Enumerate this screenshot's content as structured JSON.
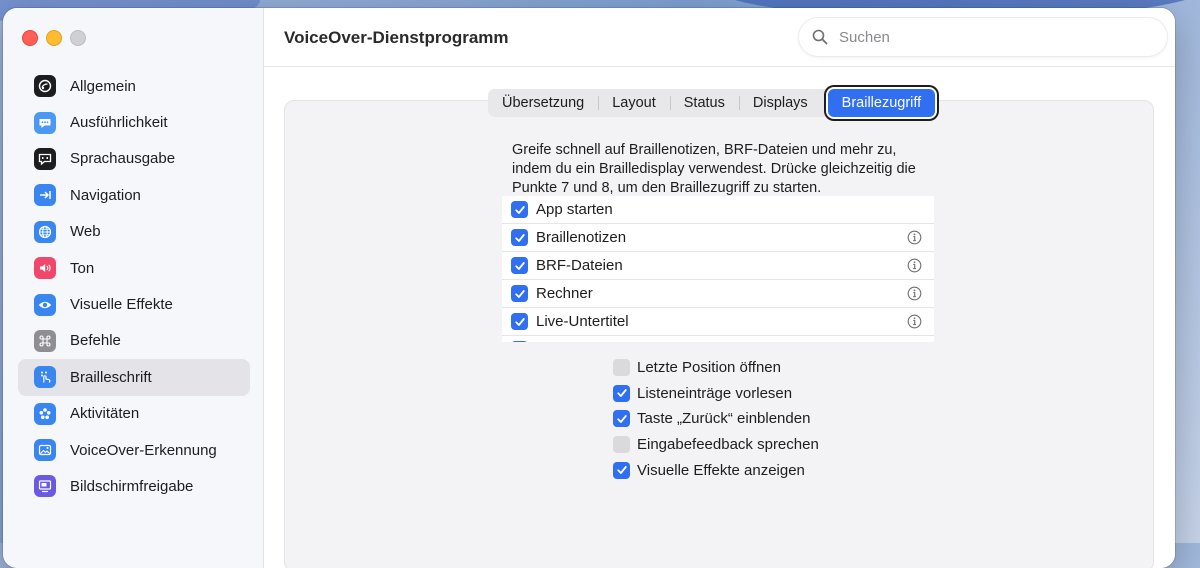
{
  "window": {
    "title": "VoiceOver-Dienstprogramm"
  },
  "search": {
    "placeholder": "Suchen"
  },
  "sidebar": {
    "items": [
      {
        "label": "Allgemein",
        "icon": "voiceover-icon",
        "color": "#1d1d1f"
      },
      {
        "label": "Ausführlichkeit",
        "icon": "speech-bubble-icon",
        "color": "#4a9af4"
      },
      {
        "label": "Sprachausgabe",
        "icon": "speech-icon",
        "color": "#1d1d1f"
      },
      {
        "label": "Navigation",
        "icon": "arrow-right-icon",
        "color": "#3a86f0"
      },
      {
        "label": "Web",
        "icon": "globe-icon",
        "color": "#3a86f0"
      },
      {
        "label": "Ton",
        "icon": "speaker-icon",
        "color": "#f0476a"
      },
      {
        "label": "Visuelle Effekte",
        "icon": "eye-icon",
        "color": "#3a86f0"
      },
      {
        "label": "Befehle",
        "icon": "command-icon",
        "color": "#8e8e93"
      },
      {
        "label": "Brailleschrift",
        "icon": "braille-icon",
        "color": "#3a86f0"
      },
      {
        "label": "Aktivitäten",
        "icon": "activities-icon",
        "color": "#3a86f0"
      },
      {
        "label": "VoiceOver-Erkennung",
        "icon": "recognition-icon",
        "color": "#3a86f0"
      },
      {
        "label": "Bildschirmfreigabe",
        "icon": "screen-sharing-icon",
        "color": "#6a5ae0"
      }
    ],
    "selected": "Brailleschrift"
  },
  "tabs": [
    {
      "label": "Übersetzung",
      "active": false
    },
    {
      "label": "Layout",
      "active": false
    },
    {
      "label": "Status",
      "active": false
    },
    {
      "label": "Displays",
      "active": false
    },
    {
      "label": "Braillezugriff",
      "active": true
    }
  ],
  "description": "Greife schnell auf Braillenotizen, BRF-Dateien und mehr zu, indem du ein Brailledisplay verwendest. Drücke gleichzeitig die Punkte 7 und 8, um den Braillezugriff zu starten.",
  "apps": [
    {
      "label": "App starten",
      "checked": true,
      "info": false
    },
    {
      "label": "Braillenotizen",
      "checked": true,
      "info": true
    },
    {
      "label": "BRF-Dateien",
      "checked": true,
      "info": true
    },
    {
      "label": "Rechner",
      "checked": true,
      "info": true
    },
    {
      "label": "Live-Untertitel",
      "checked": true,
      "info": true
    },
    {
      "label": "",
      "checked": true,
      "info": false
    }
  ],
  "options": [
    {
      "label": "Letzte Position öffnen",
      "checked": false
    },
    {
      "label": "Listeneinträge vorlesen",
      "checked": true
    },
    {
      "label": "Taste „Zurück“ einblenden",
      "checked": true
    },
    {
      "label": "Eingabefeedback sprechen",
      "checked": false
    },
    {
      "label": "Visuelle Effekte anzeigen",
      "checked": true
    }
  ],
  "colors": {
    "accent": "#2f6ff0"
  }
}
